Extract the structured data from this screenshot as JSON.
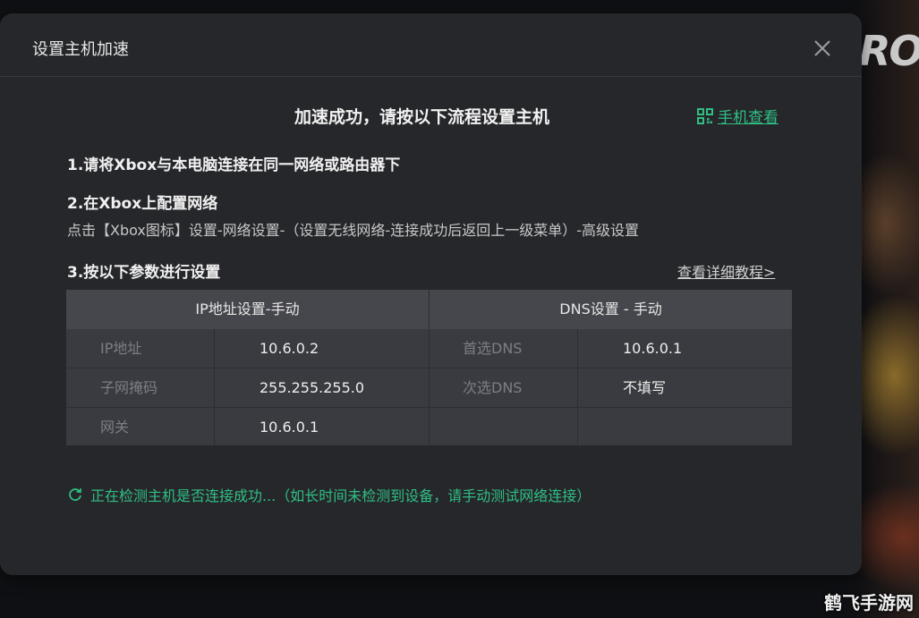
{
  "dialog": {
    "title": "设置主机加速",
    "close_icon": "close-icon"
  },
  "headline": "加速成功，请按以下流程设置主机",
  "phone_view": {
    "icon": "qr-code-icon",
    "label": "手机查看"
  },
  "steps": {
    "step1": "1.请将Xbox与本电脑连接在同一网络或路由器下",
    "step2": "2.在Xbox上配置网络",
    "step2_desc": "点击【Xbox图标】设置-网络设置-（设置无线网络-连接成功后返回上一级菜单）-高级设置",
    "step3": "3.按以下参数进行设置",
    "tutorial_link": "查看详细教程>"
  },
  "params_table": {
    "ip_header": "IP地址设置-手动",
    "dns_header": "DNS设置 - 手动",
    "ip_rows": [
      {
        "label": "IP地址",
        "value": "10.6.0.2"
      },
      {
        "label": "子网掩码",
        "value": "255.255.255.0"
      },
      {
        "label": "网关",
        "value": "10.6.0.1"
      }
    ],
    "dns_rows": [
      {
        "label": "首选DNS",
        "value": "10.6.0.1"
      },
      {
        "label": "次选DNS",
        "value": "不填写"
      },
      {
        "label": "",
        "value": ""
      }
    ]
  },
  "status": {
    "icon": "refresh-icon",
    "text": "正在检测主机是否连接成功...（如长时间未检测到设备，请手动测试网络连接）"
  },
  "background": {
    "logo_text": "RO",
    "watermark": "鹤飞手游网"
  },
  "colors": {
    "accent_green": "#2fbf84",
    "dialog_bg": "#26272b",
    "table_bg": "#3a3b40",
    "table_header_bg": "#46474c"
  }
}
